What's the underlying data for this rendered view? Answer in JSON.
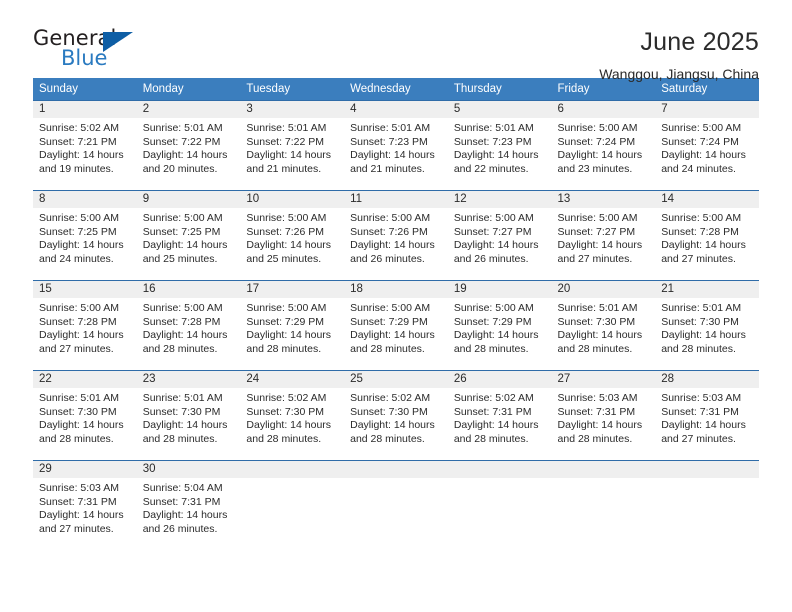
{
  "brand": {
    "name_part1": "General",
    "name_part2": "Blue",
    "logo_icon": "triangle-logo-icon"
  },
  "header": {
    "title": "June 2025",
    "subtitle": "Wanggou, Jiangsu, China"
  },
  "theme": {
    "header_blue": "#3b7ebe",
    "rule_blue": "#2f6ca8",
    "daynum_band": "#efefef",
    "logo_blue": "#0e5ea5",
    "text": "#2b2b2b"
  },
  "weekdays": [
    "Sunday",
    "Monday",
    "Tuesday",
    "Wednesday",
    "Thursday",
    "Friday",
    "Saturday"
  ],
  "weeks": [
    [
      {
        "day": "1",
        "sunrise": "Sunrise: 5:02 AM",
        "sunset": "Sunset: 7:21 PM",
        "daylight1": "Daylight: 14 hours",
        "daylight2": "and 19 minutes."
      },
      {
        "day": "2",
        "sunrise": "Sunrise: 5:01 AM",
        "sunset": "Sunset: 7:22 PM",
        "daylight1": "Daylight: 14 hours",
        "daylight2": "and 20 minutes."
      },
      {
        "day": "3",
        "sunrise": "Sunrise: 5:01 AM",
        "sunset": "Sunset: 7:22 PM",
        "daylight1": "Daylight: 14 hours",
        "daylight2": "and 21 minutes."
      },
      {
        "day": "4",
        "sunrise": "Sunrise: 5:01 AM",
        "sunset": "Sunset: 7:23 PM",
        "daylight1": "Daylight: 14 hours",
        "daylight2": "and 21 minutes."
      },
      {
        "day": "5",
        "sunrise": "Sunrise: 5:01 AM",
        "sunset": "Sunset: 7:23 PM",
        "daylight1": "Daylight: 14 hours",
        "daylight2": "and 22 minutes."
      },
      {
        "day": "6",
        "sunrise": "Sunrise: 5:00 AM",
        "sunset": "Sunset: 7:24 PM",
        "daylight1": "Daylight: 14 hours",
        "daylight2": "and 23 minutes."
      },
      {
        "day": "7",
        "sunrise": "Sunrise: 5:00 AM",
        "sunset": "Sunset: 7:24 PM",
        "daylight1": "Daylight: 14 hours",
        "daylight2": "and 24 minutes."
      }
    ],
    [
      {
        "day": "8",
        "sunrise": "Sunrise: 5:00 AM",
        "sunset": "Sunset: 7:25 PM",
        "daylight1": "Daylight: 14 hours",
        "daylight2": "and 24 minutes."
      },
      {
        "day": "9",
        "sunrise": "Sunrise: 5:00 AM",
        "sunset": "Sunset: 7:25 PM",
        "daylight1": "Daylight: 14 hours",
        "daylight2": "and 25 minutes."
      },
      {
        "day": "10",
        "sunrise": "Sunrise: 5:00 AM",
        "sunset": "Sunset: 7:26 PM",
        "daylight1": "Daylight: 14 hours",
        "daylight2": "and 25 minutes."
      },
      {
        "day": "11",
        "sunrise": "Sunrise: 5:00 AM",
        "sunset": "Sunset: 7:26 PM",
        "daylight1": "Daylight: 14 hours",
        "daylight2": "and 26 minutes."
      },
      {
        "day": "12",
        "sunrise": "Sunrise: 5:00 AM",
        "sunset": "Sunset: 7:27 PM",
        "daylight1": "Daylight: 14 hours",
        "daylight2": "and 26 minutes."
      },
      {
        "day": "13",
        "sunrise": "Sunrise: 5:00 AM",
        "sunset": "Sunset: 7:27 PM",
        "daylight1": "Daylight: 14 hours",
        "daylight2": "and 27 minutes."
      },
      {
        "day": "14",
        "sunrise": "Sunrise: 5:00 AM",
        "sunset": "Sunset: 7:28 PM",
        "daylight1": "Daylight: 14 hours",
        "daylight2": "and 27 minutes."
      }
    ],
    [
      {
        "day": "15",
        "sunrise": "Sunrise: 5:00 AM",
        "sunset": "Sunset: 7:28 PM",
        "daylight1": "Daylight: 14 hours",
        "daylight2": "and 27 minutes."
      },
      {
        "day": "16",
        "sunrise": "Sunrise: 5:00 AM",
        "sunset": "Sunset: 7:28 PM",
        "daylight1": "Daylight: 14 hours",
        "daylight2": "and 28 minutes."
      },
      {
        "day": "17",
        "sunrise": "Sunrise: 5:00 AM",
        "sunset": "Sunset: 7:29 PM",
        "daylight1": "Daylight: 14 hours",
        "daylight2": "and 28 minutes."
      },
      {
        "day": "18",
        "sunrise": "Sunrise: 5:00 AM",
        "sunset": "Sunset: 7:29 PM",
        "daylight1": "Daylight: 14 hours",
        "daylight2": "and 28 minutes."
      },
      {
        "day": "19",
        "sunrise": "Sunrise: 5:00 AM",
        "sunset": "Sunset: 7:29 PM",
        "daylight1": "Daylight: 14 hours",
        "daylight2": "and 28 minutes."
      },
      {
        "day": "20",
        "sunrise": "Sunrise: 5:01 AM",
        "sunset": "Sunset: 7:30 PM",
        "daylight1": "Daylight: 14 hours",
        "daylight2": "and 28 minutes."
      },
      {
        "day": "21",
        "sunrise": "Sunrise: 5:01 AM",
        "sunset": "Sunset: 7:30 PM",
        "daylight1": "Daylight: 14 hours",
        "daylight2": "and 28 minutes."
      }
    ],
    [
      {
        "day": "22",
        "sunrise": "Sunrise: 5:01 AM",
        "sunset": "Sunset: 7:30 PM",
        "daylight1": "Daylight: 14 hours",
        "daylight2": "and 28 minutes."
      },
      {
        "day": "23",
        "sunrise": "Sunrise: 5:01 AM",
        "sunset": "Sunset: 7:30 PM",
        "daylight1": "Daylight: 14 hours",
        "daylight2": "and 28 minutes."
      },
      {
        "day": "24",
        "sunrise": "Sunrise: 5:02 AM",
        "sunset": "Sunset: 7:30 PM",
        "daylight1": "Daylight: 14 hours",
        "daylight2": "and 28 minutes."
      },
      {
        "day": "25",
        "sunrise": "Sunrise: 5:02 AM",
        "sunset": "Sunset: 7:30 PM",
        "daylight1": "Daylight: 14 hours",
        "daylight2": "and 28 minutes."
      },
      {
        "day": "26",
        "sunrise": "Sunrise: 5:02 AM",
        "sunset": "Sunset: 7:31 PM",
        "daylight1": "Daylight: 14 hours",
        "daylight2": "and 28 minutes."
      },
      {
        "day": "27",
        "sunrise": "Sunrise: 5:03 AM",
        "sunset": "Sunset: 7:31 PM",
        "daylight1": "Daylight: 14 hours",
        "daylight2": "and 28 minutes."
      },
      {
        "day": "28",
        "sunrise": "Sunrise: 5:03 AM",
        "sunset": "Sunset: 7:31 PM",
        "daylight1": "Daylight: 14 hours",
        "daylight2": "and 27 minutes."
      }
    ],
    [
      {
        "day": "29",
        "sunrise": "Sunrise: 5:03 AM",
        "sunset": "Sunset: 7:31 PM",
        "daylight1": "Daylight: 14 hours",
        "daylight2": "and 27 minutes."
      },
      {
        "day": "30",
        "sunrise": "Sunrise: 5:04 AM",
        "sunset": "Sunset: 7:31 PM",
        "daylight1": "Daylight: 14 hours",
        "daylight2": "and 26 minutes."
      },
      {
        "day": "",
        "sunrise": "",
        "sunset": "",
        "daylight1": "",
        "daylight2": "",
        "empty": true
      },
      {
        "day": "",
        "sunrise": "",
        "sunset": "",
        "daylight1": "",
        "daylight2": "",
        "empty": true
      },
      {
        "day": "",
        "sunrise": "",
        "sunset": "",
        "daylight1": "",
        "daylight2": "",
        "empty": true
      },
      {
        "day": "",
        "sunrise": "",
        "sunset": "",
        "daylight1": "",
        "daylight2": "",
        "empty": true
      },
      {
        "day": "",
        "sunrise": "",
        "sunset": "",
        "daylight1": "",
        "daylight2": "",
        "empty": true
      }
    ]
  ]
}
